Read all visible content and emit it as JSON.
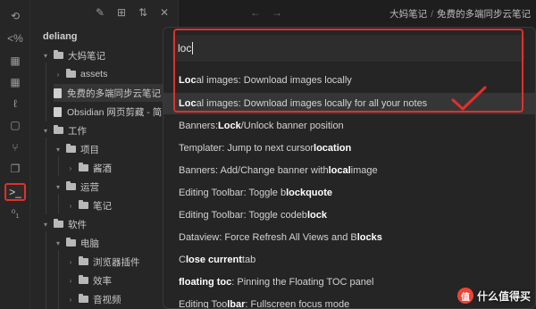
{
  "ribbon": {
    "items": [
      {
        "name": "undo-icon",
        "glyph": "⟲"
      },
      {
        "name": "percent-icon",
        "glyph": "<%"
      },
      {
        "name": "table-icon",
        "glyph": "▦"
      },
      {
        "name": "table2-icon",
        "glyph": "▦"
      },
      {
        "name": "clip-icon",
        "glyph": "ℓ"
      },
      {
        "name": "doc-icon",
        "glyph": "▢"
      },
      {
        "name": "branch-icon",
        "glyph": "⑂"
      },
      {
        "name": "copy-icon",
        "glyph": "❐"
      },
      {
        "name": "terminal-icon",
        "glyph": ">_"
      },
      {
        "name": "binary-icon",
        "glyph": "⁰₁"
      }
    ]
  },
  "explorer": {
    "toolbar": [
      "✎",
      "⊞",
      "⇅",
      "✕"
    ],
    "vault_name": "deliang",
    "items": [
      {
        "label": "大妈笔记",
        "type": "folder",
        "open": true
      },
      {
        "label": "assets",
        "type": "folder",
        "open": false
      },
      {
        "label": "免费的多端同步云笔记",
        "type": "file"
      },
      {
        "label": "Obsidian 网页剪藏 - 简",
        "type": "file"
      },
      {
        "label": "工作",
        "type": "folder",
        "open": true
      },
      {
        "label": "项目",
        "type": "folder",
        "open": true
      },
      {
        "label": "酱酒",
        "type": "folder",
        "open": false
      },
      {
        "label": "运营",
        "type": "folder",
        "open": true
      },
      {
        "label": "笔记",
        "type": "folder",
        "open": false
      },
      {
        "label": "软件",
        "type": "folder",
        "open": true
      },
      {
        "label": "电脑",
        "type": "folder",
        "open": true
      },
      {
        "label": "浏览器插件",
        "type": "folder",
        "open": false
      },
      {
        "label": "效率",
        "type": "folder",
        "open": false
      },
      {
        "label": "音视频",
        "type": "folder",
        "open": false
      }
    ]
  },
  "topbar": {
    "back": "←",
    "forward": "→",
    "breadcrumb_parent": "大妈笔记",
    "breadcrumb_sep": "/",
    "breadcrumb_current": "免费的多端同步云笔记"
  },
  "palette": {
    "query": "loc",
    "results": [
      {
        "pre": "",
        "match": "Loc",
        "post": "al images: Download images locally"
      },
      {
        "pre": "",
        "match": "Loc",
        "post": "al images: Download images locally for all your notes"
      },
      {
        "pre": "Banners: ",
        "match": "Lock",
        "post": "/Unlock banner position"
      },
      {
        "pre": "Templater: Jump to next cursor ",
        "match": "location",
        "post": ""
      },
      {
        "pre": "Banners: Add/Change banner with ",
        "match": "local",
        "post": " image"
      },
      {
        "pre": "Editing Toolbar: Toggle b",
        "match": "lockquote",
        "post": ""
      },
      {
        "pre": "Editing Toolbar: Toggle codeb",
        "match": "lock",
        "post": ""
      },
      {
        "pre": "Dataview: Force Refresh All Views and B",
        "match": "locks",
        "post": ""
      },
      {
        "pre": "C",
        "match": "lose current",
        "post": " tab"
      },
      {
        "pre": "",
        "match": "floating toc",
        "post": ": Pinning the Floating TOC panel"
      },
      {
        "pre": "Editing Too",
        "match": "lbar",
        "post": ": Fullscreen focus mode"
      }
    ],
    "highlighted_index": 1
  },
  "watermark": {
    "badge": "值",
    "text": "什么值得买"
  },
  "colors": {
    "annotation_red": "#e0302b",
    "background": "#1e1e1e",
    "panel": "#262626"
  }
}
